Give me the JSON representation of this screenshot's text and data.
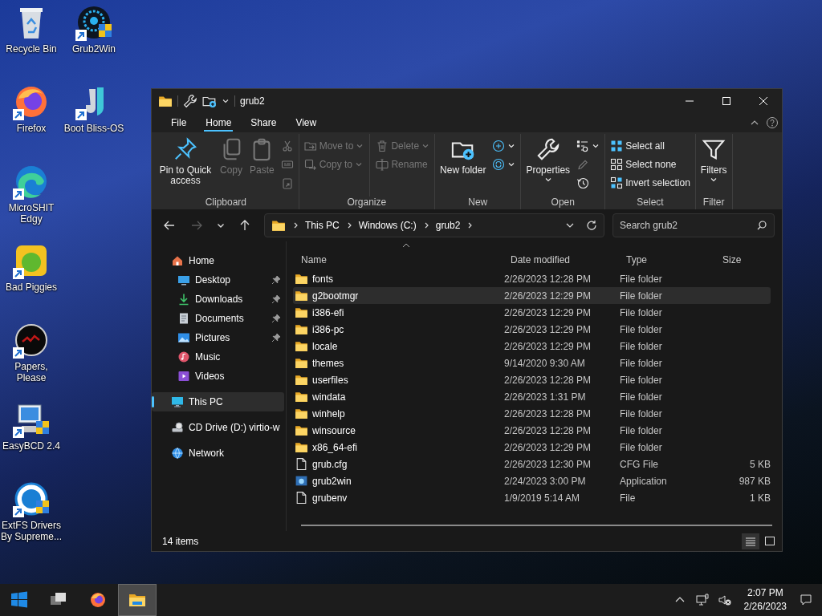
{
  "desktop": {
    "icons": [
      {
        "kind": "recycle",
        "label": "Recycle Bin",
        "shortcut": false
      },
      {
        "kind": "firefox",
        "label": "Firefox",
        "shortcut": true
      },
      {
        "kind": "edge",
        "label": "MicroSHIT Edgy",
        "shortcut": true
      },
      {
        "kind": "piggies",
        "label": "Bad Piggies",
        "shortcut": true
      },
      {
        "kind": "papers",
        "label": "Papers, Please",
        "shortcut": true
      },
      {
        "kind": "easybcd",
        "label": "EasyBCD 2.4",
        "shortcut": true
      },
      {
        "kind": "extfs",
        "label": "ExtFS Drivers By Supreme...",
        "shortcut": true
      },
      {
        "kind": "grub",
        "label": "Grub2Win",
        "shortcut": true
      },
      {
        "kind": "bliss",
        "label": "Boot Bliss-OS",
        "shortcut": true
      }
    ]
  },
  "window": {
    "title": "grub2",
    "ribbon_tabs": [
      {
        "label": "File",
        "selected": false
      },
      {
        "label": "Home",
        "selected": true
      },
      {
        "label": "Share",
        "selected": false
      },
      {
        "label": "View",
        "selected": false
      }
    ],
    "ribbon_groups": [
      {
        "label": "Clipboard",
        "items": [
          {
            "kind": "large",
            "label": "Pin to Quick access",
            "disabled": false,
            "dropdown": false
          },
          {
            "kind": "large",
            "label": "Copy",
            "disabled": true,
            "dropdown": false
          },
          {
            "kind": "large",
            "label": "Paste",
            "disabled": true,
            "dropdown": false
          },
          {
            "kind": "stack",
            "items": [
              {
                "kind": "icon",
                "disabled": true,
                "dropdown": false
              },
              {
                "kind": "icon",
                "disabled": true,
                "dropdown": false
              },
              {
                "kind": "icon",
                "disabled": true,
                "dropdown": false
              }
            ]
          }
        ]
      },
      {
        "label": "Organize",
        "items": [
          {
            "kind": "stack",
            "items": [
              {
                "kind": "small",
                "label": "Move to",
                "disabled": true,
                "dropdown": true
              },
              {
                "kind": "small",
                "label": "Copy to",
                "disabled": true,
                "dropdown": true
              }
            ]
          },
          {
            "kind": "stack",
            "items": [
              {
                "kind": "small",
                "label": "Delete",
                "disabled": true,
                "dropdown": true
              },
              {
                "kind": "small",
                "label": "Rename",
                "disabled": true,
                "dropdown": false
              }
            ]
          }
        ]
      },
      {
        "label": "New",
        "items": [
          {
            "kind": "large",
            "label": "New folder",
            "disabled": false,
            "dropdown": false
          },
          {
            "kind": "stack",
            "items": [
              {
                "kind": "icon",
                "disabled": false,
                "dropdown": true
              },
              {
                "kind": "icon",
                "disabled": false,
                "dropdown": true
              }
            ]
          }
        ]
      },
      {
        "label": "Open",
        "items": [
          {
            "kind": "large",
            "label": "Properties",
            "disabled": false,
            "dropdown": true
          },
          {
            "kind": "stack",
            "items": [
              {
                "kind": "icon",
                "disabled": false,
                "dropdown": true
              },
              {
                "kind": "icon",
                "disabled": true,
                "dropdown": false
              },
              {
                "kind": "icon",
                "disabled": false,
                "dropdown": false
              }
            ]
          }
        ]
      },
      {
        "label": "Select",
        "items": [
          {
            "kind": "stack",
            "items": [
              {
                "kind": "small",
                "label": "Select all",
                "disabled": false,
                "dropdown": false
              },
              {
                "kind": "small",
                "label": "Select none",
                "disabled": false,
                "dropdown": false
              },
              {
                "kind": "small",
                "label": "Invert selection",
                "disabled": false,
                "dropdown": false
              }
            ]
          }
        ]
      },
      {
        "label": "Filter",
        "items": [
          {
            "kind": "large",
            "label": "Filters",
            "disabled": false,
            "dropdown": true
          }
        ]
      }
    ],
    "nav_buttons": [
      {
        "kind": "back",
        "disabled": false
      },
      {
        "kind": "forward",
        "disabled": true
      },
      {
        "kind": "recent",
        "disabled": false
      },
      {
        "kind": "up",
        "disabled": false
      }
    ],
    "address": {
      "segments": [
        "This PC",
        "Windows (C:)",
        "grub2"
      ]
    },
    "search": {
      "placeholder": "Search grub2"
    },
    "navigation_pane": [
      {
        "kind": "home",
        "label": "Home",
        "selected": false,
        "pinned": false,
        "children": [
          {
            "kind": "desktop",
            "label": "Desktop",
            "selected": false,
            "pinned": true
          },
          {
            "kind": "downloads",
            "label": "Downloads",
            "selected": false,
            "pinned": true
          },
          {
            "kind": "documents",
            "label": "Documents",
            "selected": false,
            "pinned": true
          },
          {
            "kind": "pictures",
            "label": "Pictures",
            "selected": false,
            "pinned": true
          },
          {
            "kind": "music",
            "label": "Music",
            "selected": false,
            "pinned": false
          },
          {
            "kind": "videos",
            "label": "Videos",
            "selected": false,
            "pinned": false
          }
        ]
      },
      {
        "kind": "pc",
        "label": "This PC",
        "selected": true,
        "pinned": false
      },
      {
        "kind": "drive",
        "label": "CD Drive (D:) virtio-w",
        "selected": false,
        "pinned": false
      },
      {
        "kind": "network",
        "label": "Network",
        "selected": false,
        "pinned": false
      }
    ],
    "file_list": {
      "columns": [
        {
          "label": "Name",
          "sorted": true
        },
        {
          "label": "Date modified",
          "sorted": false
        },
        {
          "label": "Type",
          "sorted": false
        },
        {
          "label": "Size",
          "sorted": false
        }
      ],
      "rows": [
        {
          "kind": "folder",
          "name": "fonts",
          "date": "2/26/2023 12:28 PM",
          "type": "File folder",
          "highlighted": false
        },
        {
          "kind": "folder",
          "name": "g2bootmgr",
          "date": "2/26/2023 12:29 PM",
          "type": "File folder",
          "highlighted": true
        },
        {
          "kind": "folder",
          "name": "i386-efi",
          "date": "2/26/2023 12:29 PM",
          "type": "File folder",
          "highlighted": false
        },
        {
          "kind": "folder",
          "name": "i386-pc",
          "date": "2/26/2023 12:29 PM",
          "type": "File folder",
          "highlighted": false
        },
        {
          "kind": "folder",
          "name": "locale",
          "date": "2/26/2023 12:29 PM",
          "type": "File folder",
          "highlighted": false
        },
        {
          "kind": "folder",
          "name": "themes",
          "date": "9/14/2020 9:30 AM",
          "type": "File folder",
          "highlighted": false
        },
        {
          "kind": "folder",
          "name": "userfiles",
          "date": "2/26/2023 12:28 PM",
          "type": "File folder",
          "highlighted": false
        },
        {
          "kind": "folder",
          "name": "windata",
          "date": "2/26/2023 1:31 PM",
          "type": "File folder",
          "highlighted": false
        },
        {
          "kind": "folder",
          "name": "winhelp",
          "date": "2/26/2023 12:28 PM",
          "type": "File folder",
          "highlighted": false
        },
        {
          "kind": "folder",
          "name": "winsource",
          "date": "2/26/2023 12:28 PM",
          "type": "File folder",
          "highlighted": false
        },
        {
          "kind": "folder",
          "name": "x86_64-efi",
          "date": "2/26/2023 12:29 PM",
          "type": "File folder",
          "highlighted": false
        },
        {
          "kind": "document",
          "name": "grub.cfg",
          "date": "2/26/2023 12:30 PM",
          "type": "CFG File",
          "size": "5 KB",
          "highlighted": false
        },
        {
          "kind": "application",
          "name": "grub2win",
          "date": "2/24/2023 3:00 PM",
          "type": "Application",
          "size": "987 KB",
          "highlighted": false
        },
        {
          "kind": "document",
          "name": "grubenv",
          "date": "1/9/2019 5:14 AM",
          "type": "File",
          "size": "1 KB",
          "highlighted": false
        }
      ]
    },
    "status_bar": {
      "item_count": "14 items",
      "views": [
        {
          "kind": "details",
          "selected": true
        },
        {
          "kind": "tiles",
          "selected": false
        }
      ]
    }
  },
  "taskbar": {
    "apps": [
      {
        "kind": "start",
        "active": false
      },
      {
        "kind": "taskview",
        "active": false
      },
      {
        "kind": "firefox",
        "active": false
      },
      {
        "kind": "explorer",
        "active": true
      }
    ],
    "clock": {
      "time": "2:07 PM",
      "date": "2/26/2023"
    }
  }
}
